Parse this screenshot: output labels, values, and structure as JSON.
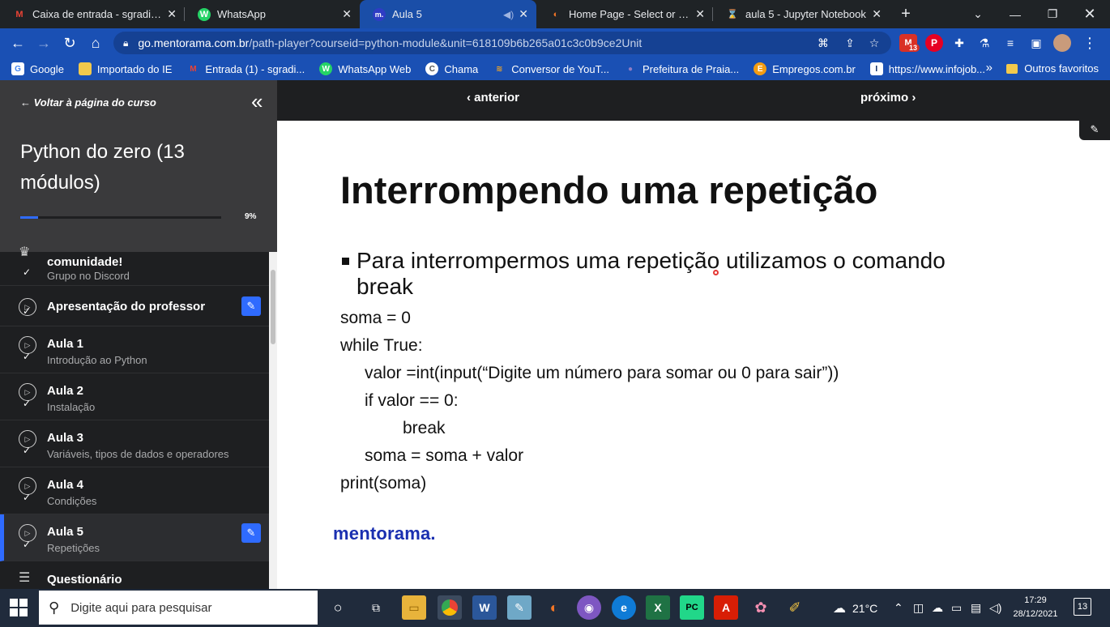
{
  "browser": {
    "tabs": [
      {
        "title": "Caixa de entrada - sgradioati",
        "favicon": "M",
        "favicon_color": "#ea4335"
      },
      {
        "title": "WhatsApp",
        "favicon": "W",
        "favicon_color": "#25d366"
      },
      {
        "title": "Aula 5",
        "favicon": "m.",
        "favicon_color": "#2f3cc4"
      },
      {
        "title": "Home Page - Select or create",
        "favicon": "◐",
        "favicon_color": "#f37626"
      },
      {
        "title": "aula 5 - Jupyter Notebook",
        "favicon": "⌛",
        "favicon_color": "#f37626"
      }
    ],
    "url_host": "go.mentorama.com.br",
    "url_rest": "/path-player?courseid=python-module&unit=618109b6b265a01c3c0b9ce2Unit",
    "mail_badge": "13",
    "bookmarks": [
      {
        "label": "Google",
        "icon": "G",
        "color": "#4285f4"
      },
      {
        "label": "Importado do IE",
        "icon": "▇",
        "color": "#f2c94c"
      },
      {
        "label": "Entrada (1) - sgradi...",
        "icon": "M",
        "color": "#ea4335"
      },
      {
        "label": "WhatsApp Web",
        "icon": "W",
        "color": "#25d366"
      },
      {
        "label": "Chama",
        "icon": "C",
        "color": "#555555"
      },
      {
        "label": "Conversor de YouT...",
        "icon": "≋",
        "color": "#f5a623"
      },
      {
        "label": "Prefeitura de Praia...",
        "icon": "●",
        "color": "#8e7cc3"
      },
      {
        "label": "Empregos.com.br",
        "icon": "E",
        "color": "#f39c12"
      },
      {
        "label": "https://www.infojob...",
        "icon": "I",
        "color": "#0a2a66"
      }
    ],
    "bookmarks_more": "»",
    "other_bookmarks": "Outros favoritos"
  },
  "sidebar": {
    "back_label": "← Voltar à página do curso",
    "course_title": "Python do zero (13 módulos)",
    "progress_percent": 9,
    "progress_label": "9%",
    "lessons": [
      {
        "title": "comunidade!",
        "subtitle": "Grupo no Discord",
        "done": true,
        "icon": "people-icon"
      },
      {
        "title": "Apresentação do professor",
        "subtitle": "",
        "done": true,
        "attachment": true
      },
      {
        "title": "Aula 1",
        "subtitle": "Introdução ao Python",
        "done": true
      },
      {
        "title": "Aula 2",
        "subtitle": "Instalação",
        "done": true
      },
      {
        "title": "Aula 3",
        "subtitle": "Variáveis, tipos de dados e operadores",
        "done": true
      },
      {
        "title": "Aula 4",
        "subtitle": "Condições",
        "done": true
      },
      {
        "title": "Aula 5",
        "subtitle": "Repetições",
        "done": true,
        "attachment": true,
        "active": true
      },
      {
        "title": "Questionário",
        "subtitle": "",
        "done": false,
        "icon": "quiz-icon"
      }
    ]
  },
  "lesson_nav": {
    "prev": "‹ anterior",
    "next": "próximo ›"
  },
  "slide": {
    "title": "Interrompendo uma repetição",
    "bullet": "Para interrompermos uma repetição utilizamos o comando break",
    "code_lines": [
      "soma = 0",
      "while True:",
      "valor =int(input(“Digite um número para somar ou 0 para sair”))",
      "if valor == 0:",
      "break",
      "soma = soma + valor",
      "print(soma)"
    ],
    "brand": "mentorama."
  },
  "taskbar": {
    "search_placeholder": "Digite aqui para pesquisar",
    "weather": "21°C",
    "time": "17:29",
    "date": "28/12/2021",
    "notifications": "13"
  }
}
